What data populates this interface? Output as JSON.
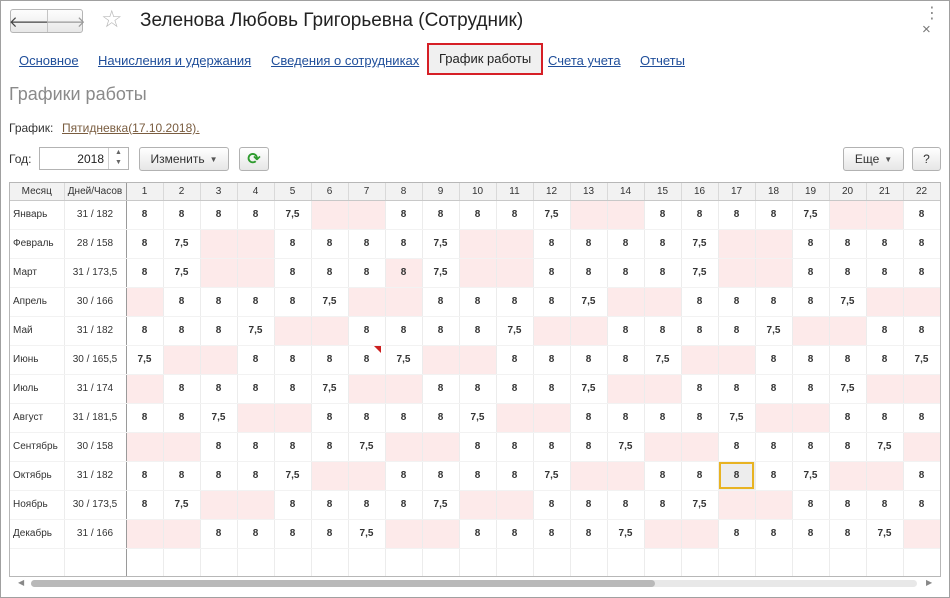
{
  "window": {
    "title": "Зеленова Любовь Григорьевна (Сотрудник)",
    "back_glyph": "🡐",
    "forward_glyph": "🡒",
    "star_glyph": "☆",
    "menu_glyph": "⋮",
    "close_glyph": "×"
  },
  "tabs": [
    {
      "label": "Основное"
    },
    {
      "label": "Начисления и удержания"
    },
    {
      "label": "Сведения о сотрудниках"
    },
    {
      "label": "График работы",
      "active": true
    },
    {
      "label": "Счета учета"
    },
    {
      "label": "Отчеты"
    }
  ],
  "section_title": "Графики работы",
  "schedule": {
    "label": "График:",
    "link": "Пятидневка(17.10.2018)."
  },
  "toolbar": {
    "year_label": "Год:",
    "year_value": "2018",
    "change_label": "Изменить",
    "more_label": "Еще",
    "help_label": "?",
    "refresh_glyph": "⟳"
  },
  "grid": {
    "headers": {
      "month": "Месяц",
      "total": "Дней/Часов"
    },
    "days": [
      "1",
      "2",
      "3",
      "4",
      "5",
      "6",
      "7",
      "8",
      "9",
      "10",
      "11",
      "12",
      "13",
      "14",
      "15",
      "16",
      "17",
      "18",
      "19",
      "20",
      "21",
      "22"
    ],
    "rows": [
      {
        "month": "Январь",
        "total": "31 / 182",
        "cells": [
          "8",
          "8",
          "8",
          "8",
          "7,5",
          "",
          "",
          "8",
          "8",
          "8",
          "8",
          "7,5",
          "",
          "",
          "8",
          "8",
          "8",
          "8",
          "7,5",
          "",
          "",
          "8"
        ]
      },
      {
        "month": "Февраль",
        "total": "28 / 158",
        "cells": [
          "8",
          "7,5",
          "",
          "",
          "8",
          "8",
          "8",
          "8",
          "7,5",
          "",
          "",
          "8",
          "8",
          "8",
          "8",
          "7,5",
          "",
          "",
          "8",
          "8",
          "8",
          "8"
        ]
      },
      {
        "month": "Март",
        "total": "31 / 173,5",
        "cells": [
          "8",
          "7,5",
          "",
          "",
          "8",
          "8",
          "8",
          "8",
          "7,5",
          "",
          "",
          "8",
          "8",
          "8",
          "8",
          "7,5",
          "",
          "",
          "8",
          "8",
          "8",
          "8"
        ]
      },
      {
        "month": "Апрель",
        "total": "30 / 166",
        "cells": [
          "",
          "8",
          "8",
          "8",
          "8",
          "7,5",
          "",
          "",
          "8",
          "8",
          "8",
          "8",
          "7,5",
          "",
          "",
          "8",
          "8",
          "8",
          "8",
          "7,5",
          "",
          ""
        ]
      },
      {
        "month": "Май",
        "total": "31 / 182",
        "cells": [
          "8",
          "8",
          "8",
          "7,5",
          "",
          "",
          "8",
          "8",
          "8",
          "8",
          "7,5",
          "",
          "",
          "8",
          "8",
          "8",
          "8",
          "7,5",
          "",
          "",
          "8",
          "8"
        ]
      },
      {
        "month": "Июнь",
        "total": "30 / 165,5",
        "cells": [
          "7,5",
          "",
          "",
          "8",
          "8",
          "8",
          "8",
          "7,5",
          "",
          "",
          "8",
          "8",
          "8",
          "8",
          "7,5",
          "",
          "",
          "8",
          "8",
          "8",
          "8",
          "7,5"
        ]
      },
      {
        "month": "Июль",
        "total": "31 / 174",
        "cells": [
          "",
          "8",
          "8",
          "8",
          "8",
          "7,5",
          "",
          "",
          "8",
          "8",
          "8",
          "8",
          "7,5",
          "",
          "",
          "8",
          "8",
          "8",
          "8",
          "7,5",
          "",
          ""
        ]
      },
      {
        "month": "Август",
        "total": "31 / 181,5",
        "cells": [
          "8",
          "8",
          "7,5",
          "",
          "",
          "8",
          "8",
          "8",
          "8",
          "7,5",
          "",
          "",
          "8",
          "8",
          "8",
          "8",
          "7,5",
          "",
          "",
          "8",
          "8",
          "8"
        ]
      },
      {
        "month": "Сентябрь",
        "total": "30 / 158",
        "cells": [
          "",
          "",
          "8",
          "8",
          "8",
          "8",
          "7,5",
          "",
          "",
          "8",
          "8",
          "8",
          "8",
          "7,5",
          "",
          "",
          "8",
          "8",
          "8",
          "8",
          "7,5",
          ""
        ]
      },
      {
        "month": "Октябрь",
        "total": "31 / 182",
        "cells": [
          "8",
          "8",
          "8",
          "8",
          "7,5",
          "",
          "",
          "8",
          "8",
          "8",
          "8",
          "7,5",
          "",
          "",
          "8",
          "8",
          "8",
          "8",
          "7,5",
          "",
          "",
          "8"
        ]
      },
      {
        "month": "Ноябрь",
        "total": "30 / 173,5",
        "cells": [
          "8",
          "7,5",
          "",
          "",
          "8",
          "8",
          "8",
          "8",
          "7,5",
          "",
          "",
          "8",
          "8",
          "8",
          "8",
          "7,5",
          "",
          "",
          "8",
          "8",
          "8",
          "8"
        ]
      },
      {
        "month": "Декабрь",
        "total": "31 / 166",
        "cells": [
          "",
          "",
          "8",
          "8",
          "8",
          "8",
          "7,5",
          "",
          "",
          "8",
          "8",
          "8",
          "8",
          "7,5",
          "",
          "",
          "8",
          "8",
          "8",
          "8",
          "7,5",
          ""
        ]
      }
    ],
    "off_days": [
      [
        6,
        7,
        13,
        14,
        20,
        21
      ],
      [
        3,
        4,
        10,
        11,
        17,
        18
      ],
      [
        3,
        4,
        8,
        10,
        11,
        17,
        18
      ],
      [
        1,
        7,
        8,
        14,
        15,
        21,
        22
      ],
      [
        5,
        6,
        12,
        13,
        19,
        20
      ],
      [
        2,
        3,
        9,
        10,
        16,
        17
      ],
      [
        1,
        7,
        8,
        14,
        15,
        21,
        22
      ],
      [
        4,
        5,
        11,
        12,
        18,
        19
      ],
      [
        1,
        2,
        8,
        9,
        15,
        16,
        22
      ],
      [
        6,
        7,
        13,
        14,
        20,
        21
      ],
      [
        3,
        4,
        10,
        11,
        17,
        18
      ],
      [
        1,
        2,
        8,
        9,
        15,
        16,
        22
      ]
    ],
    "selected": {
      "row": 9,
      "day": 17
    },
    "flagged": {
      "row": 5,
      "day": 7
    }
  },
  "colors": {
    "accent_border": "#d61f26",
    "weekend_fill": "#fdeaea",
    "selection": "#e8b322",
    "link": "#1f4e9a"
  }
}
